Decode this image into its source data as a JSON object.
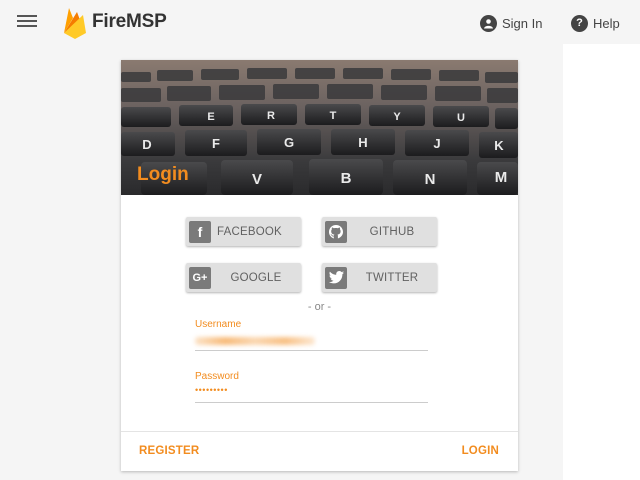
{
  "header": {
    "brand": "FireMSP",
    "signin_label": "Sign In",
    "help_label": "Help"
  },
  "login_card": {
    "title": "Login",
    "social": [
      {
        "label": "FACEBOOK",
        "icon": "facebook-icon",
        "glyph": "f"
      },
      {
        "label": "GITHUB",
        "icon": "github-icon",
        "glyph": ""
      },
      {
        "label": "GOOGLE",
        "icon": "google-plus-icon",
        "glyph": "G+"
      },
      {
        "label": "TWITTER",
        "icon": "twitter-icon",
        "glyph": ""
      }
    ],
    "separator": "- or -",
    "username_label": "Username",
    "password_label": "Password",
    "password_masked": "•••••••••",
    "register_label": "REGISTER",
    "login_label": "LOGIN"
  },
  "colors": {
    "accent": "#f28c1f",
    "button_bg": "#e0e0e0"
  }
}
